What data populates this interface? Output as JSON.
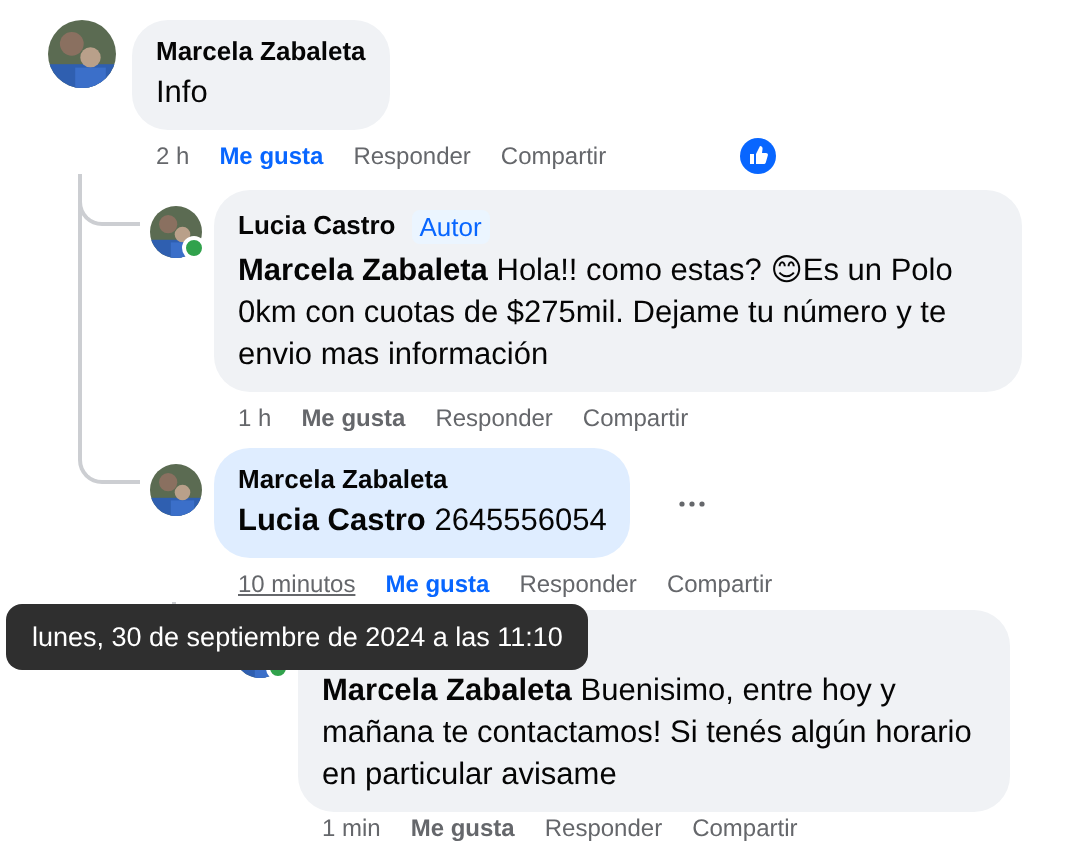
{
  "comments": [
    {
      "author": "Marcela Zabaleta",
      "body": [
        {
          "kind": "text",
          "text": "Info"
        }
      ],
      "time": "2 h",
      "actions": [
        "Me gusta",
        "Responder",
        "Compartir"
      ],
      "liked": true,
      "reacted": true,
      "children": [
        {
          "author": "Lucia Castro",
          "badge": "Autor",
          "online": true,
          "body": [
            {
              "kind": "mention",
              "text": "Marcela Zabaleta"
            },
            {
              "kind": "text",
              "text": " Hola!! como estas? 😊Es un Polo 0km con cuotas de $275mil. Dejame tu número y te envio mas información"
            }
          ],
          "time": "1 h",
          "actions": [
            "Me gusta",
            "Responder",
            "Compartir"
          ],
          "liked": false
        },
        {
          "author": "Marcela Zabaleta",
          "highlighted": true,
          "body": [
            {
              "kind": "mention",
              "text": "Lucia Castro"
            },
            {
              "kind": "text",
              "text": " 2645556054"
            }
          ],
          "time": "10 minutos",
          "time_hovered": true,
          "actions": [
            "Me gusta",
            "Responder",
            "Compartir"
          ],
          "liked": true,
          "menu_visible": true,
          "children": [
            {
              "online": true,
              "body": [
                {
                  "kind": "mention",
                  "text": "Marcela Zabaleta"
                },
                {
                  "kind": "text",
                  "text": " Buenisimo, entre hoy y mañana te contactamos! Si tenés algún horario en particular avisame"
                }
              ],
              "time": "1 min",
              "actions": [
                "Me gusta",
                "Responder",
                "Compartir"
              ],
              "liked": false
            }
          ]
        }
      ]
    }
  ],
  "tooltip": {
    "text": "lunes, 30 de septiembre de 2024 a las 11:10"
  }
}
